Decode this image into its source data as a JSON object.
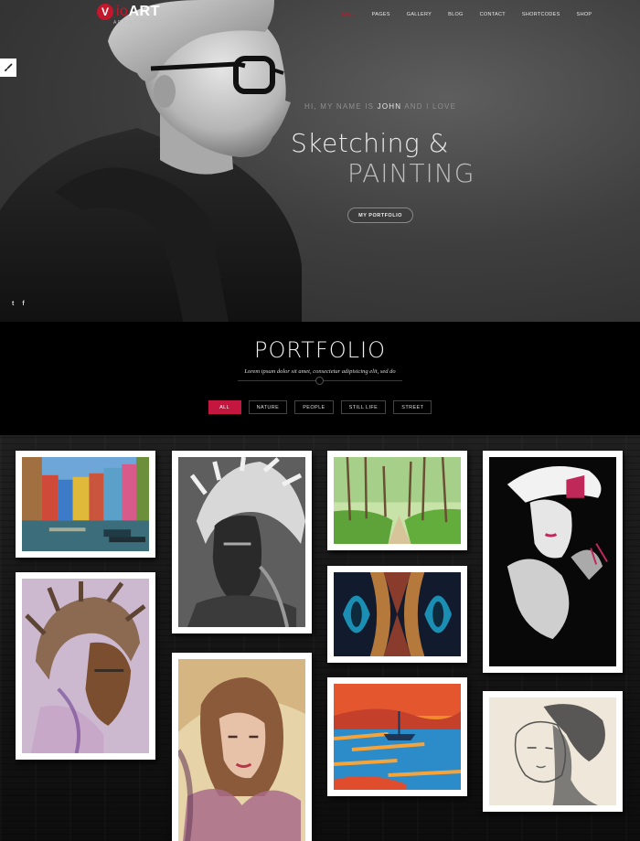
{
  "brand": {
    "mark": "V",
    "name_light": "io",
    "name_bold": "ART",
    "tagline": "ARTIST PORTFOLIO"
  },
  "nav": [
    "HOME",
    "PAGES",
    "GALLERY",
    "BLOG",
    "CONTACT",
    "SHORTCODES",
    "SHOP"
  ],
  "hero": {
    "intro_pre": "HI, MY NAME IS",
    "intro_name": "JOHN",
    "intro_post": "AND I LOVE",
    "line1": "Sketching &",
    "line2": "PAINTING",
    "button": "MY PORTFOLIO"
  },
  "social": {
    "twitter": "t",
    "facebook": "f"
  },
  "portfolio": {
    "title": "PORTFOLIO",
    "subtitle": "Lorem ipsum dolor sit amet, consectetur adipisicing elit, sed do",
    "filters": [
      "ALL",
      "NATURE",
      "PEOPLE",
      "STILL LIFE",
      "STREET"
    ],
    "active_filter": "ALL"
  },
  "gallery": [
    {
      "name": "canal-houses-painting"
    },
    {
      "name": "native-chief-sketch"
    },
    {
      "name": "forest-path-painting"
    },
    {
      "name": "woman-with-hat-painting"
    },
    {
      "name": "chief-watercolor-painting"
    },
    {
      "name": "abstract-symmetry-painting"
    },
    {
      "name": "woman-portrait-painting"
    },
    {
      "name": "sunset-boat-painting"
    },
    {
      "name": "ink-portrait-sketch"
    }
  ],
  "colors": {
    "accent": "#c3172c",
    "filter_active": "#c3173f"
  }
}
